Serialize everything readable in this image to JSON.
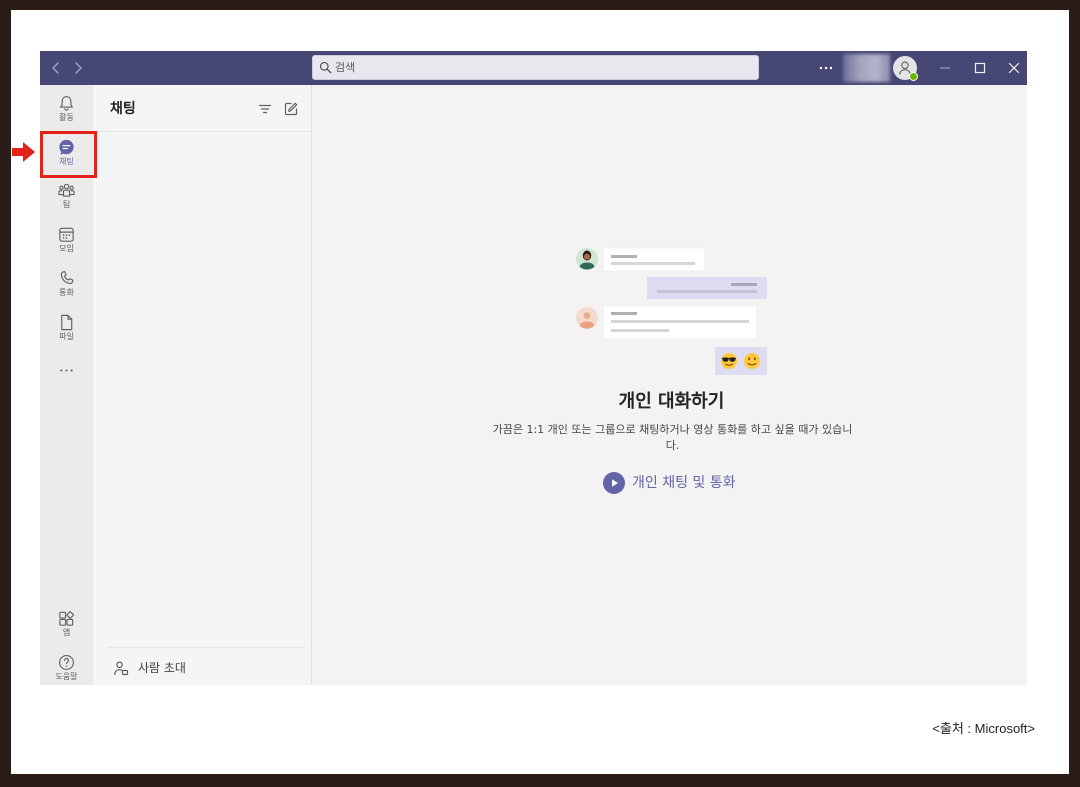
{
  "titlebar": {
    "search_placeholder": "검색",
    "icons": [
      "chevron-left-icon",
      "chevron-right-icon",
      "search-icon",
      "more-icon",
      "avatar-icon",
      "minimize-icon",
      "maximize-icon",
      "close-icon"
    ]
  },
  "rail": {
    "items": [
      {
        "label": "활동",
        "icon": "bell-icon",
        "active": false
      },
      {
        "label": "채팅",
        "icon": "chat-icon",
        "active": true
      },
      {
        "label": "팀",
        "icon": "teams-icon",
        "active": false
      },
      {
        "label": "모임",
        "icon": "calendar-icon",
        "active": false
      },
      {
        "label": "통화",
        "icon": "phone-icon",
        "active": false
      },
      {
        "label": "파일",
        "icon": "file-icon",
        "active": false
      }
    ],
    "more_icon": "more-icon",
    "bottom_items": [
      {
        "label": "앱",
        "icon": "apps-icon"
      },
      {
        "label": "도움말",
        "icon": "help-icon"
      }
    ]
  },
  "chat_list": {
    "title": "채팅",
    "header_icons": [
      "filter-icon",
      "compose-icon"
    ],
    "invite": {
      "label": "사람 초대",
      "icon": "person-add-icon"
    }
  },
  "empty_state": {
    "title": "개인 대화하기",
    "description": "가끔은 1:1 개인 또는 그룹으로 채팅하거나 영상 통화를 하고 싶을 때가 있습니다.",
    "link": {
      "label": "개인 채팅 및 통화",
      "icon": "play-icon"
    },
    "illustration_emoji": [
      "sunglasses-face-icon",
      "smiling-face-icon"
    ]
  },
  "annotation": {
    "caption": "<출처 : Microsoft>",
    "arrow_icon": "red-arrow-icon"
  },
  "colors": {
    "frame": "#2b1c17",
    "titlebar": "#464775",
    "accent": "#6264a7",
    "highlight": "#e2231a",
    "presence": "#6bb700"
  }
}
